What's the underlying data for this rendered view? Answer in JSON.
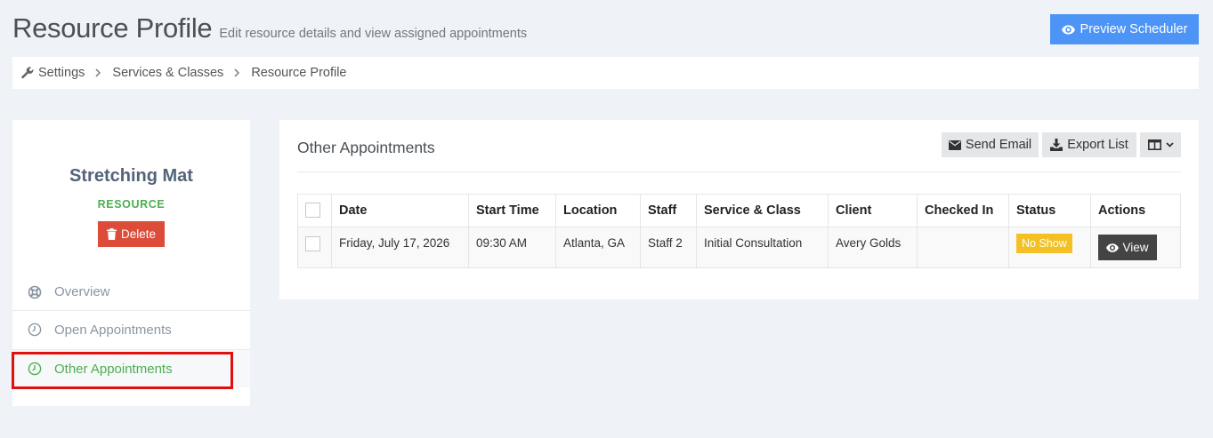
{
  "header": {
    "title": "Resource Profile",
    "subtitle": "Edit resource details and view assigned appointments",
    "preview_button": "Preview Scheduler"
  },
  "breadcrumb": [
    "Settings",
    "Services & Classes",
    "Resource Profile"
  ],
  "profile": {
    "name": "Stretching Mat",
    "type": "RESOURCE",
    "delete_label": "Delete"
  },
  "nav": [
    {
      "label": "Overview",
      "icon": "lifebuoy-icon"
    },
    {
      "label": "Open Appointments",
      "icon": "clock-icon"
    },
    {
      "label": "Other Appointments",
      "icon": "clock-icon",
      "active": true
    }
  ],
  "main": {
    "title": "Other Appointments",
    "send_email": "Send Email",
    "export_list": "Export List",
    "columns_icon": "columns-icon"
  },
  "table": {
    "headers": [
      "Date",
      "Start Time",
      "Location",
      "Staff",
      "Service & Class",
      "Client",
      "Checked In",
      "Status",
      "Actions"
    ],
    "rows": [
      {
        "date": "Friday, July 17, 2026",
        "start_time": "09:30 AM",
        "location": "Atlanta, GA",
        "staff": "Staff 2",
        "service": "Initial Consultation",
        "client": "Avery Golds",
        "checked_in": "",
        "status": "No Show",
        "action": "View"
      }
    ]
  },
  "colors": {
    "accent_blue": "#4d94f7",
    "delete_red": "#dd4b39",
    "active_green": "#4caf50",
    "status_yellow": "#f3c125",
    "highlight_red": "#e20f0f"
  }
}
